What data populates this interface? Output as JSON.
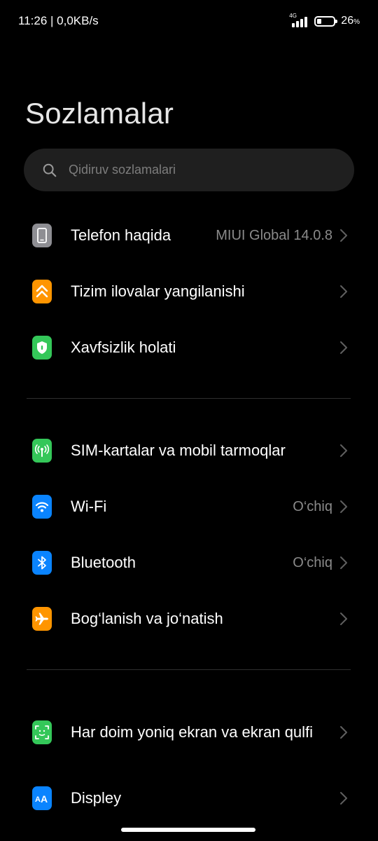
{
  "status_bar": {
    "time_speed": "11:26 | 0,0KB/s",
    "network": "4G",
    "battery_level": 0.26,
    "battery_percent": "26",
    "battery_suffix": "%"
  },
  "title": "Sozlamalar",
  "search": {
    "placeholder": "Qidiruv sozlamalari",
    "icon": "search-icon"
  },
  "settings": [
    {
      "label": "Telefon haqida",
      "value": "MIUI Global 14.0.8",
      "icon": "phone-icon",
      "color": "#8e8e93"
    },
    {
      "label": "Tizim ilovalar yangilanishi",
      "value": "",
      "icon": "update-arrows-icon",
      "color": "#ff9500"
    },
    {
      "label": "Xavfsizlik holati",
      "value": "",
      "icon": "shield-icon",
      "color": "#34c759"
    },
    {
      "label": "SIM-kartalar va mobil tarmoqlar",
      "value": "",
      "icon": "antenna-icon",
      "color": "#34c759"
    },
    {
      "label": "Wi-Fi",
      "value": "O‘chiq",
      "icon": "wifi-icon",
      "color": "#0a84ff"
    },
    {
      "label": "Bluetooth",
      "value": "O‘chiq",
      "icon": "bluetooth-icon",
      "color": "#0a84ff"
    },
    {
      "label": "Bog‘lanish va jo‘natish",
      "value": "",
      "icon": "airplane-icon",
      "color": "#ff9500"
    },
    {
      "label": "Har doim yoniq ekran va ekran qulfi",
      "value": "",
      "icon": "face-lock-icon",
      "color": "#34c759"
    },
    {
      "label": "Displey",
      "value": "",
      "icon": "text-size-icon",
      "color": "#0a84ff"
    }
  ]
}
